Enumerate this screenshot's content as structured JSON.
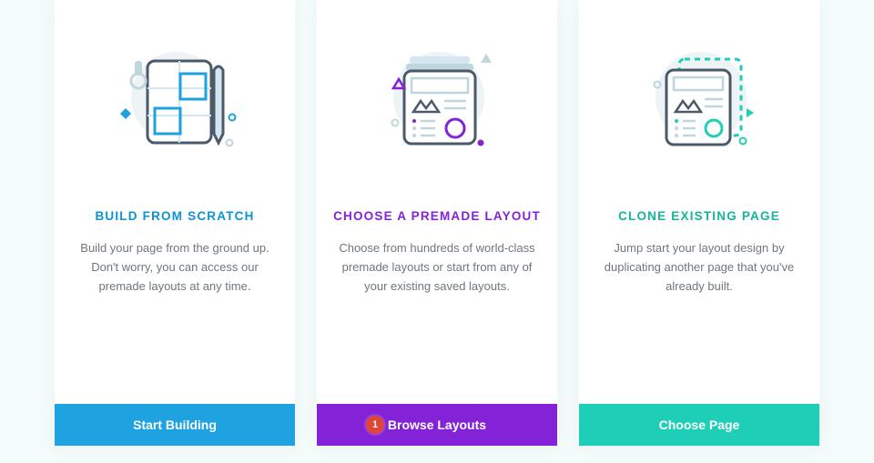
{
  "cards": [
    {
      "title": "BUILD FROM SCRATCH",
      "description": "Build your page from the ground up. Don't worry, you can access our premade layouts at any time.",
      "button_label": "Start Building",
      "title_color": "#0b93d4",
      "button_color": "#1ea2e0",
      "icon": "build-scratch"
    },
    {
      "title": "CHOOSE A PREMADE LAYOUT",
      "description": "Choose from hundreds of world-class premade layouts or start from any of your existing saved layouts.",
      "button_label": "Browse Layouts",
      "badge": "1",
      "title_color": "#8322d6",
      "button_color": "#8322d6",
      "icon": "premade-layout"
    },
    {
      "title": "CLONE EXISTING PAGE",
      "description": "Jump start your layout design by duplicating another page that you've already built.",
      "button_label": "Choose Page",
      "title_color": "#16b39f",
      "button_color": "#1fceb6",
      "icon": "clone-page"
    }
  ]
}
